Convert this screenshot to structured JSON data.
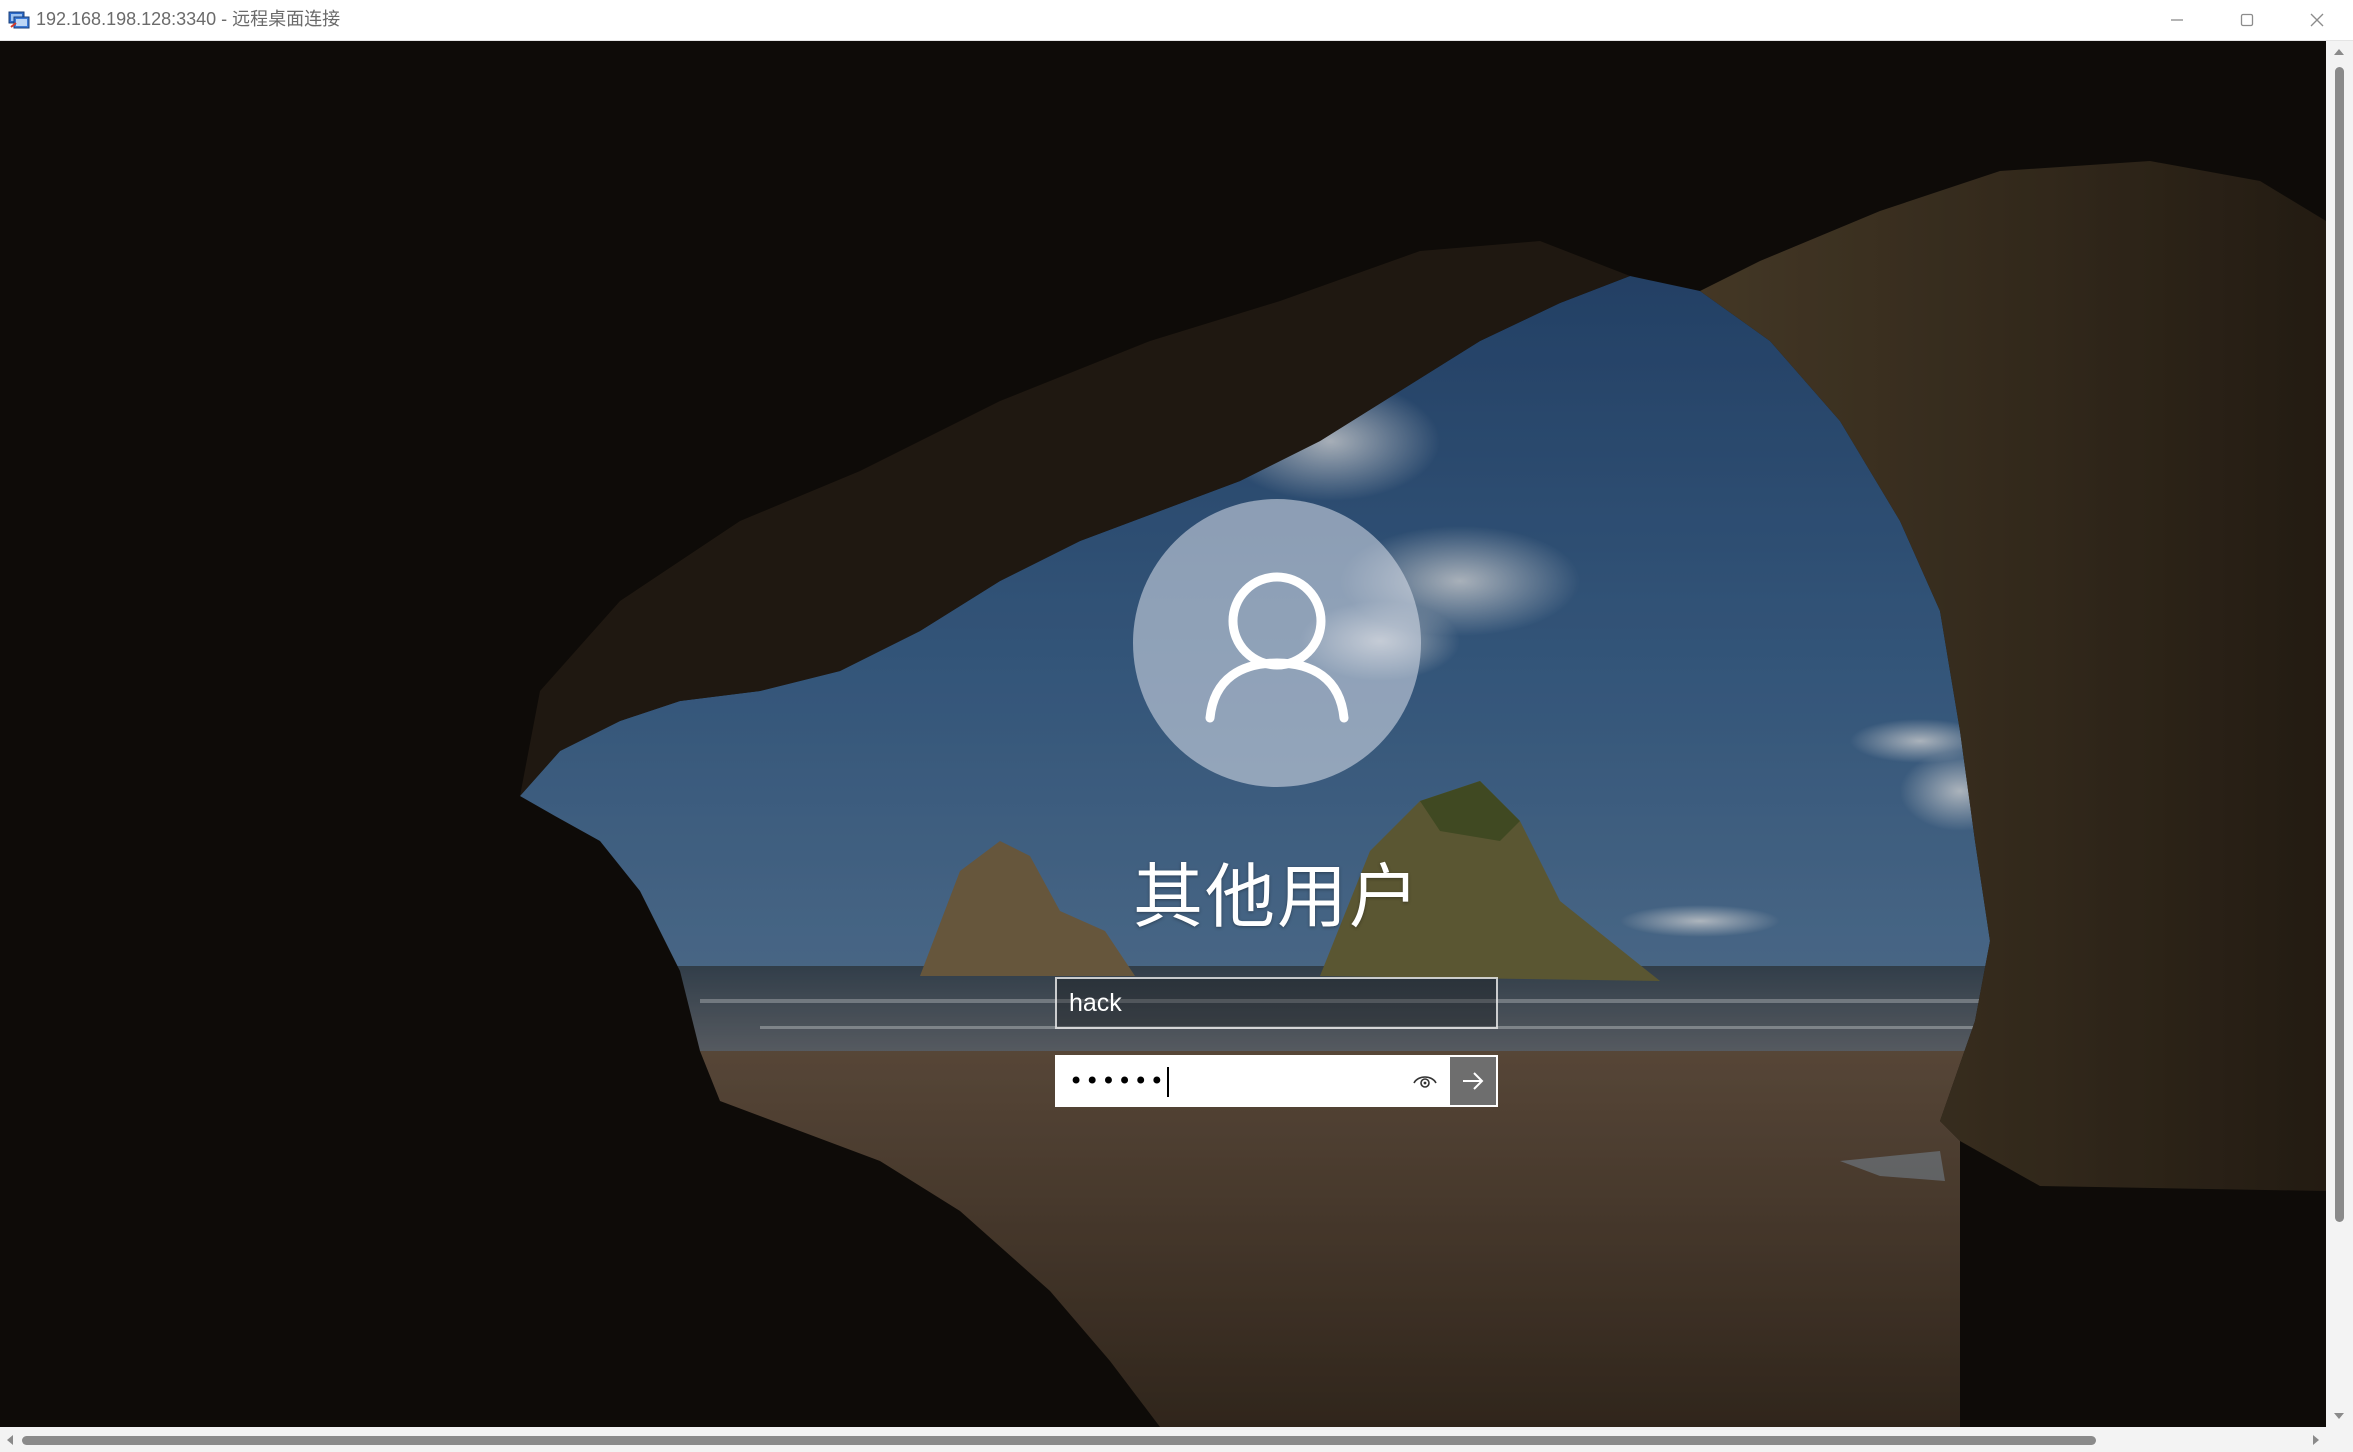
{
  "window": {
    "title": "192.168.198.128:3340 - 远程桌面连接",
    "app_icon": "remote-desktop-icon",
    "controls": [
      "minimize-icon",
      "maximize-icon",
      "close-icon"
    ]
  },
  "login": {
    "avatar_icon": "user-avatar-icon",
    "account_name": "其他用户",
    "username_value": "hack",
    "password_value": "••••••",
    "reveal_icon": "eye-icon",
    "submit_icon": "arrow-right-icon"
  },
  "colors": {
    "titlebar": "#ffffff",
    "submit_button": "#6e6e6e",
    "scrollbar_thumb": "#8a8a8a"
  }
}
